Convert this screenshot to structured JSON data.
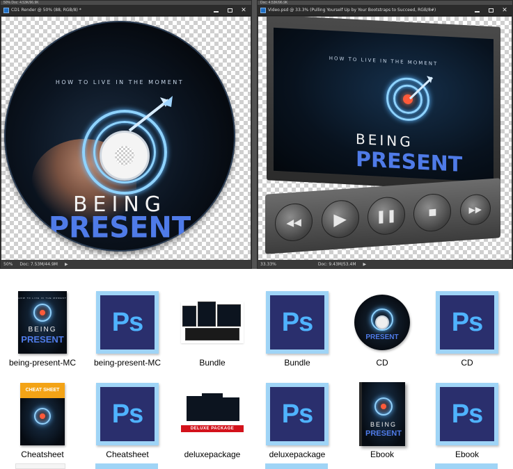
{
  "left_window": {
    "topstrip": "50% Doc: 4.53K/96.9K",
    "title": "CD1 Render @ 50% (88, RGB/8) *",
    "zoom": "50%",
    "doc": "Doc: 7.53M/44.9M",
    "cd_tagline": "HOW TO LIVE IN THE MOMENT",
    "cd_title_1": "BEING",
    "cd_title_2": "PRESENT"
  },
  "right_window": {
    "topstrip": "Doc: 4.53K/96.9K",
    "title": "Video.psd @ 33.3% (Pulling Yourself Up  by Your Bootstraps to Succeed, RGB/8#)",
    "zoom": "33.33%",
    "doc": "Doc: 9.43M/53.4M",
    "screen_tagline": "HOW TO LIVE IN THE MOMENT",
    "screen_title_1": "BEING",
    "screen_title_2": "PRESENT",
    "controls": {
      "rewind": "◀◀",
      "play": "▶",
      "pause": "❚❚",
      "stop": "■",
      "forward": "▶▶"
    }
  },
  "icons": {
    "ps_text": "Ps",
    "cover_tag": "HOW TO LIVE IN THE MOMENT",
    "cover_being": "BEING",
    "cover_present": "PRESENT",
    "cheat_band": "CHEAT SHEET",
    "deluxe_ribbon": "DELUXE PACKAGE"
  },
  "files": [
    {
      "label": "being-present-MC",
      "type": "cover"
    },
    {
      "label": "being-present-MC",
      "type": "psd"
    },
    {
      "label": "Bundle",
      "type": "bundle"
    },
    {
      "label": "Bundle",
      "type": "psd"
    },
    {
      "label": "CD",
      "type": "cd"
    },
    {
      "label": "CD",
      "type": "psd"
    },
    {
      "label": "Cheatsheet",
      "type": "cheatsheet"
    },
    {
      "label": "Cheatsheet",
      "type": "psd"
    },
    {
      "label": "deluxepackage",
      "type": "deluxe"
    },
    {
      "label": "deluxepackage",
      "type": "psd"
    },
    {
      "label": "Ebook",
      "type": "ebook"
    },
    {
      "label": "Ebook",
      "type": "psd"
    }
  ],
  "colors": {
    "ps_blue": "#2a2f6d",
    "ps_letters": "#4fb3ff",
    "present_blue": "#4f7be8",
    "cheat_orange": "#f3a316",
    "deluxe_red": "#d3121b"
  }
}
